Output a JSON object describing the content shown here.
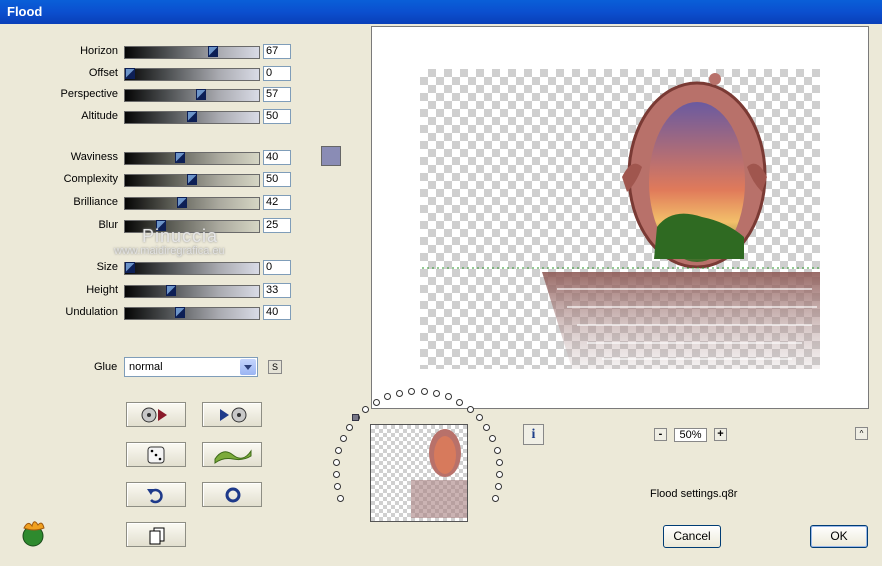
{
  "window": {
    "title": "Flood"
  },
  "params": [
    {
      "label": "Horizon",
      "value": "67",
      "fraction": 0.67,
      "style": "a"
    },
    {
      "label": "Offset",
      "value": "0",
      "fraction": 0.0,
      "style": "a"
    },
    {
      "label": "Perspective",
      "value": "57",
      "fraction": 0.57,
      "style": "a"
    },
    {
      "label": "Altitude",
      "value": "50",
      "fraction": 0.5,
      "style": "a"
    },
    {
      "label": "Waviness",
      "value": "40",
      "fraction": 0.4,
      "style": "b"
    },
    {
      "label": "Complexity",
      "value": "50",
      "fraction": 0.5,
      "style": "b"
    },
    {
      "label": "Brilliance",
      "value": "42",
      "fraction": 0.42,
      "style": "b"
    },
    {
      "label": "Blur",
      "value": "25",
      "fraction": 0.25,
      "style": "b"
    },
    {
      "label": "Size",
      "value": "0",
      "fraction": 0.0,
      "style": "a"
    },
    {
      "label": "Height",
      "value": "33",
      "fraction": 0.33,
      "style": "a"
    },
    {
      "label": "Undulation",
      "value": "40",
      "fraction": 0.4,
      "style": "a"
    }
  ],
  "color_swatch": "#8a8cb5",
  "watermark": {
    "name": "Pinuccia",
    "site": "www.maidiregrafica.eu"
  },
  "glue": {
    "label": "Glue",
    "selected": "normal",
    "side_button": "S"
  },
  "zoom": {
    "minus": "-",
    "value": "50%",
    "plus": "+"
  },
  "info_label": "i",
  "up_label": "^",
  "settings_file": "Flood settings.q8r",
  "buttons": {
    "cancel": "Cancel",
    "ok": "OK"
  }
}
